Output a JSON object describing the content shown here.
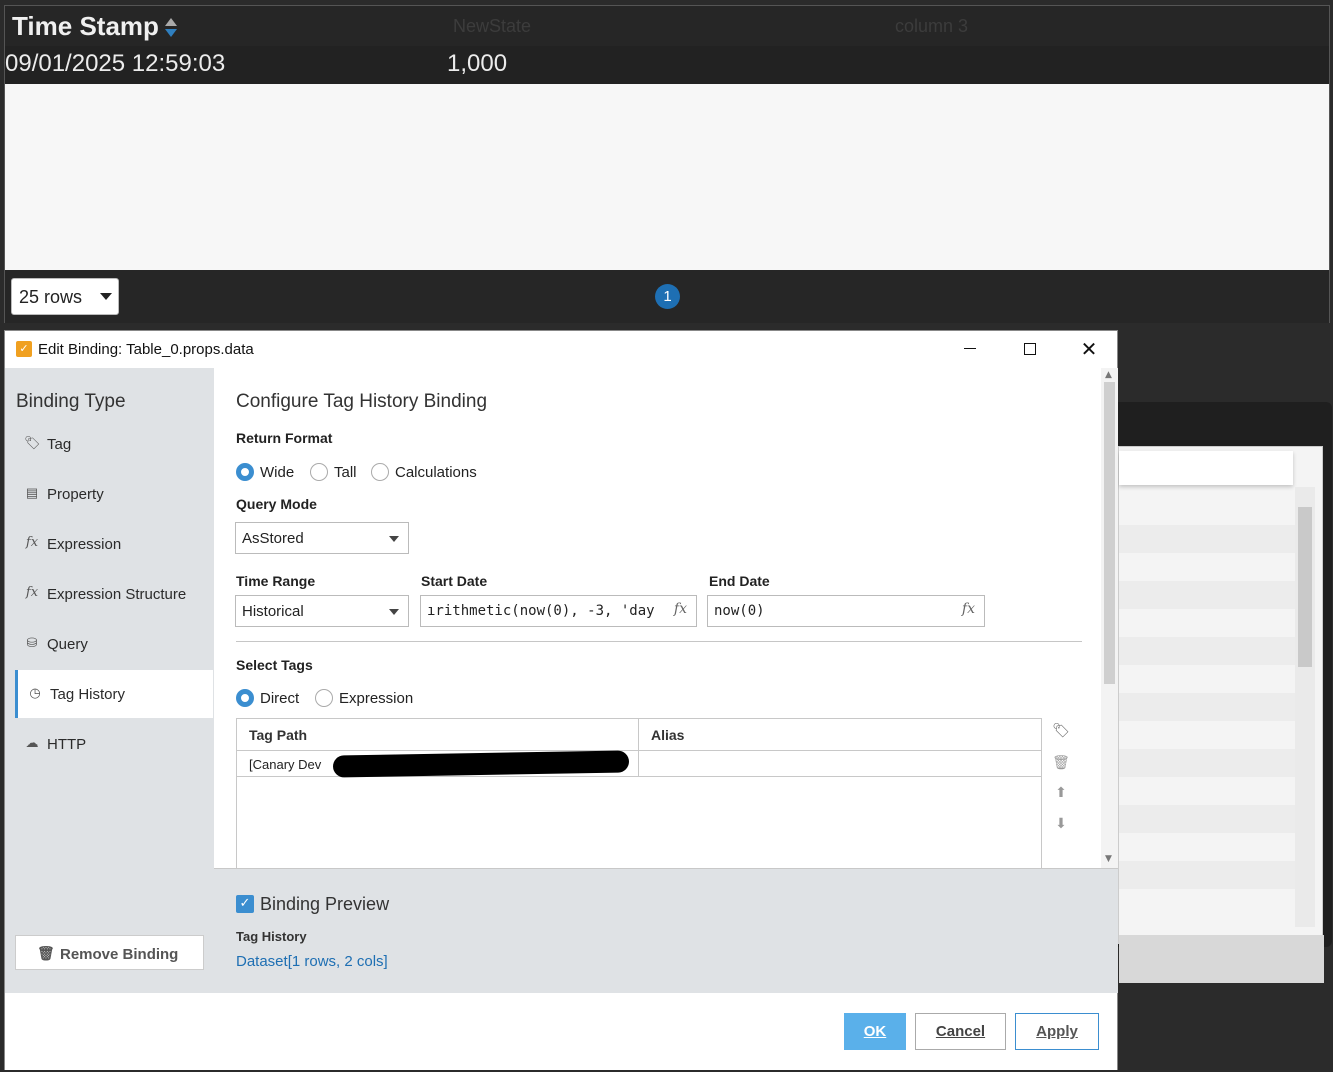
{
  "table": {
    "columns": [
      "Time Stamp",
      "NewState",
      "column 3"
    ],
    "row": {
      "timestamp": "09/01/2025 12:59:03",
      "value": "1,000"
    },
    "rows_per_page": "25 rows",
    "current_page": "1"
  },
  "dialog": {
    "title": "Edit Binding: Table_0.props.data",
    "nav": {
      "title": "Binding Type",
      "items": [
        {
          "label": "Tag",
          "icon": "tag-icon"
        },
        {
          "label": "Property",
          "icon": "property-icon"
        },
        {
          "label": "Expression",
          "icon": "fx-icon"
        },
        {
          "label": "Expression Structure",
          "icon": "fx-icon"
        },
        {
          "label": "Query",
          "icon": "database-icon"
        },
        {
          "label": "Tag History",
          "icon": "clock-icon"
        },
        {
          "label": "HTTP",
          "icon": "cloud-icon"
        }
      ],
      "active": "Tag History",
      "remove_label": "Remove Binding"
    },
    "config": {
      "title": "Configure Tag History Binding",
      "return_format": {
        "label": "Return Format",
        "options": [
          "Wide",
          "Tall",
          "Calculations"
        ],
        "selected": "Wide"
      },
      "query_mode": {
        "label": "Query Mode",
        "value": "AsStored"
      },
      "time_range": {
        "label": "Time Range",
        "value": "Historical"
      },
      "start_date": {
        "label": "Start Date",
        "value": "ırithmetic(now(0), -3, 'day"
      },
      "end_date": {
        "label": "End Date",
        "value": "now(0)"
      },
      "select_tags": {
        "label": "Select Tags",
        "options": [
          "Direct",
          "Expression"
        ],
        "selected": "Direct"
      },
      "tags_table": {
        "headers": [
          "Tag Path",
          "Alias"
        ],
        "rows": [
          {
            "path": "[Canary Dev",
            "alias": ""
          }
        ]
      }
    },
    "preview": {
      "label": "Binding Preview",
      "sub_label": "Tag History",
      "value": "Dataset[1 rows, 2 cols]"
    },
    "buttons": {
      "ok": "OK",
      "cancel": "Cancel",
      "apply": "Apply"
    }
  }
}
